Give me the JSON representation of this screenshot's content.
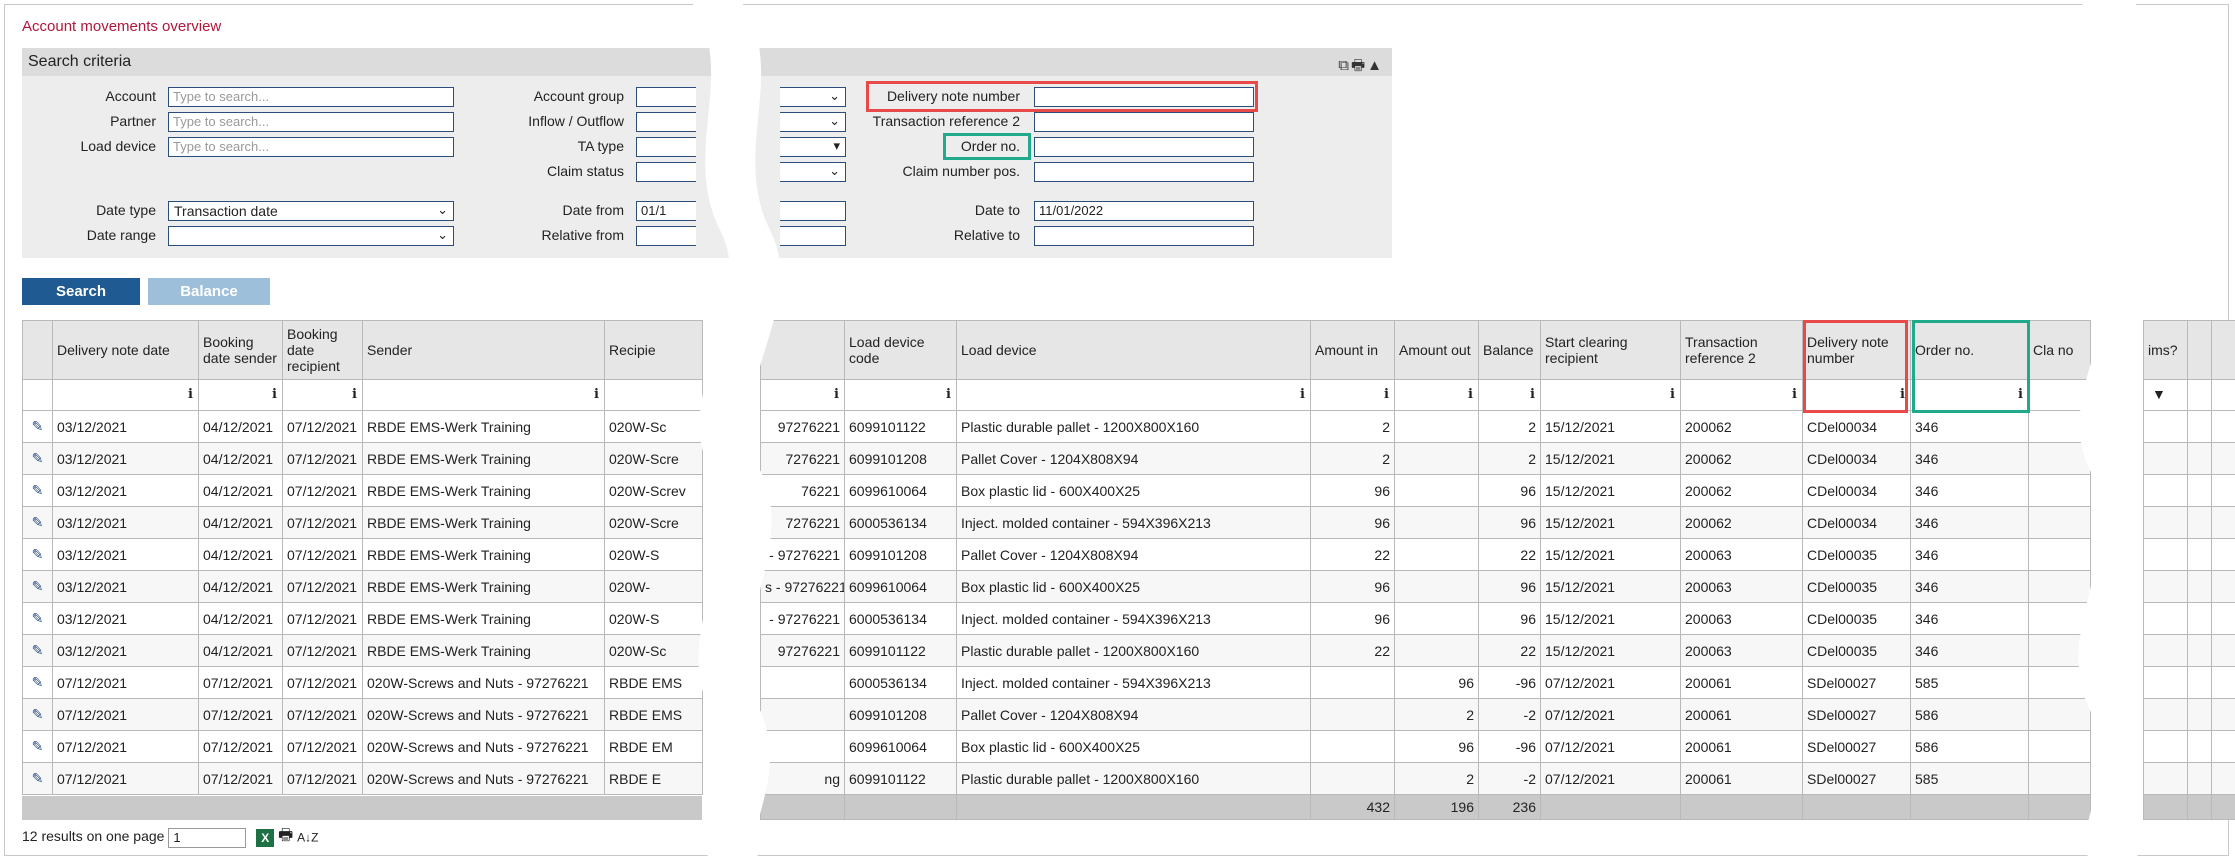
{
  "page_title": "Account movements overview",
  "search_criteria": {
    "title": "Search criteria",
    "header_icons": "⧉🖶▲",
    "account_label": "Account",
    "account_placeholder": "Type to search...",
    "partner_label": "Partner",
    "partner_placeholder": "Type to search...",
    "load_device_label": "Load device",
    "load_device_placeholder": "Type to search...",
    "account_group_label": "Account group",
    "inflow_outflow_label": "Inflow / Outflow",
    "ta_type_label": "TA type",
    "claim_status_label": "Claim status",
    "delivery_note_label": "Delivery note number",
    "transaction_ref2_label": "Transaction reference 2",
    "order_no_label": "Order no.",
    "claim_number_pos_label": "Claim number pos.",
    "date_type_label": "Date type",
    "date_type_value": "Transaction date",
    "date_range_label": "Date range",
    "date_from_label": "Date from",
    "date_from_value": "01/1",
    "relative_from_label": "Relative from",
    "date_to_label": "Date to",
    "date_to_value": "11/01/2022",
    "relative_to_label": "Relative to"
  },
  "buttons": {
    "search": "Search",
    "balance": "Balance"
  },
  "left_table": {
    "headers": [
      "Delivery note date",
      "Booking date sender",
      "Booking date recipient",
      "Sender",
      "Recipie"
    ],
    "rows": [
      [
        "03/12/2021",
        "04/12/2021",
        "07/12/2021",
        "RBDE EMS-Werk Training",
        "020W-Sc"
      ],
      [
        "03/12/2021",
        "04/12/2021",
        "07/12/2021",
        "RBDE EMS-Werk Training",
        "020W-Scre"
      ],
      [
        "03/12/2021",
        "04/12/2021",
        "07/12/2021",
        "RBDE EMS-Werk Training",
        "020W-Screv"
      ],
      [
        "03/12/2021",
        "04/12/2021",
        "07/12/2021",
        "RBDE EMS-Werk Training",
        "020W-Scre"
      ],
      [
        "03/12/2021",
        "04/12/2021",
        "07/12/2021",
        "RBDE EMS-Werk Training",
        "020W-S"
      ],
      [
        "03/12/2021",
        "04/12/2021",
        "07/12/2021",
        "RBDE EMS-Werk Training",
        "020W-"
      ],
      [
        "03/12/2021",
        "04/12/2021",
        "07/12/2021",
        "RBDE EMS-Werk Training",
        "020W-S"
      ],
      [
        "03/12/2021",
        "04/12/2021",
        "07/12/2021",
        "RBDE EMS-Werk Training",
        "020W-Sc"
      ],
      [
        "07/12/2021",
        "07/12/2021",
        "07/12/2021",
        "020W-Screws and Nuts - 97276221",
        "RBDE EMS"
      ],
      [
        "07/12/2021",
        "07/12/2021",
        "07/12/2021",
        "020W-Screws and Nuts - 97276221",
        "RBDE EMS"
      ],
      [
        "07/12/2021",
        "07/12/2021",
        "07/12/2021",
        "020W-Screws and Nuts - 97276221",
        "RBDE EM"
      ],
      [
        "07/12/2021",
        "07/12/2021",
        "07/12/2021",
        "020W-Screws and Nuts - 97276221",
        "RBDE E"
      ]
    ]
  },
  "mid_table": {
    "headers": [
      "",
      "Load device code",
      "Load device",
      "Amount in",
      "Amount out",
      "Balance",
      "Start clearing recipient",
      "Transaction reference 2",
      "Delivery note number",
      "Order no.",
      "Cla no"
    ],
    "rows": [
      [
        "97276221",
        "6099101122",
        "Plastic durable pallet - 1200X800X160",
        "2",
        "",
        "2",
        "15/12/2021",
        "200062",
        "CDel00034",
        "346"
      ],
      [
        "7276221",
        "6099101208",
        "Pallet Cover - 1204X808X94",
        "2",
        "",
        "2",
        "15/12/2021",
        "200062",
        "CDel00034",
        "346"
      ],
      [
        "76221",
        "6099610064",
        "Box plastic lid - 600X400X25",
        "96",
        "",
        "96",
        "15/12/2021",
        "200062",
        "CDel00034",
        "346"
      ],
      [
        "7276221",
        "6000536134",
        "Inject. molded container - 594X396X213",
        "96",
        "",
        "96",
        "15/12/2021",
        "200062",
        "CDel00034",
        "346"
      ],
      [
        "- 97276221",
        "6099101208",
        "Pallet Cover - 1204X808X94",
        "22",
        "",
        "22",
        "15/12/2021",
        "200063",
        "CDel00035",
        "346"
      ],
      [
        "s - 97276221",
        "6099610064",
        "Box plastic lid - 600X400X25",
        "96",
        "",
        "96",
        "15/12/2021",
        "200063",
        "CDel00035",
        "346"
      ],
      [
        "- 97276221",
        "6000536134",
        "Inject. molded container - 594X396X213",
        "96",
        "",
        "96",
        "15/12/2021",
        "200063",
        "CDel00035",
        "346"
      ],
      [
        "97276221",
        "6099101122",
        "Plastic durable pallet - 1200X800X160",
        "22",
        "",
        "22",
        "15/12/2021",
        "200063",
        "CDel00035",
        "346"
      ],
      [
        "",
        "6000536134",
        "Inject. molded container - 594X396X213",
        "",
        "96",
        "-96",
        "07/12/2021",
        "200061",
        "SDel00027",
        "585"
      ],
      [
        "",
        "6099101208",
        "Pallet Cover - 1204X808X94",
        "",
        "2",
        "-2",
        "07/12/2021",
        "200061",
        "SDel00027",
        "586"
      ],
      [
        "",
        "6099610064",
        "Box plastic lid - 600X400X25",
        "",
        "96",
        "-96",
        "07/12/2021",
        "200061",
        "SDel00027",
        "586"
      ],
      [
        "ng",
        "6099101122",
        "Plastic durable pallet - 1200X800X160",
        "",
        "2",
        "-2",
        "07/12/2021",
        "200061",
        "SDel00027",
        "585"
      ]
    ],
    "totals": [
      "432",
      "196",
      "236"
    ]
  },
  "right_fragment": {
    "header": "ims?"
  },
  "footer": {
    "results_text": "12 results on one page",
    "page_value": "1",
    "excel_icon": "X",
    "print_icon": "🖶",
    "sort_icon": "A↓Z"
  }
}
